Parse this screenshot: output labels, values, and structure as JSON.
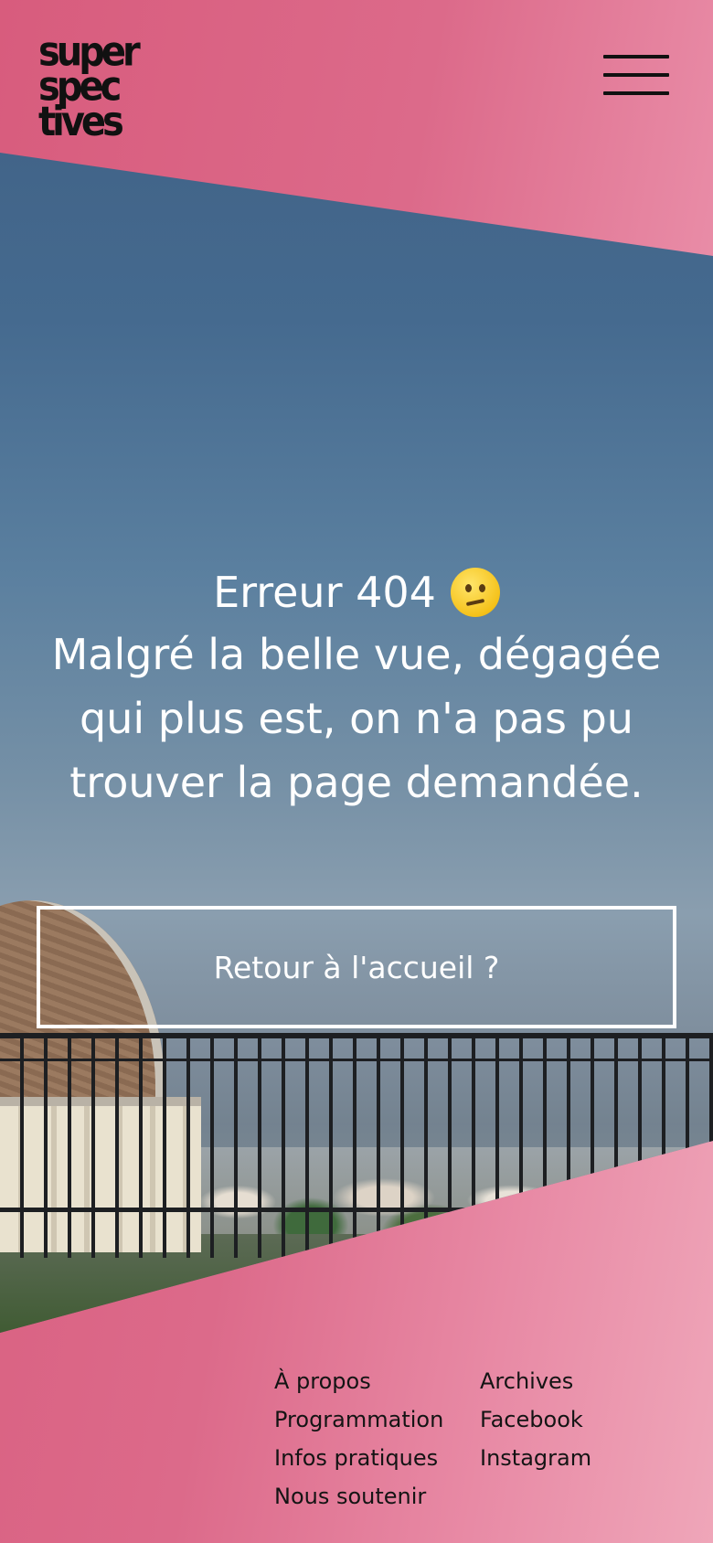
{
  "header": {
    "logo_lines": [
      "super",
      "spec",
      "tives"
    ],
    "menu_icon": "hamburger-menu-icon"
  },
  "error": {
    "title": "Erreur 404",
    "emoji": "confused-face-emoji",
    "message": "Malgré la belle vue, dégagée qui plus est, on n'a pas pu trouver la page demandée."
  },
  "cta": {
    "label": "Retour à l'accueil ?"
  },
  "footer": {
    "col1": [
      "À propos",
      "Programmation",
      "Infos pratiques",
      "Nous soutenir"
    ],
    "col2": [
      "Archives",
      "Facebook",
      "Instagram"
    ]
  },
  "colors": {
    "pink_start": "#d85c7d",
    "pink_end": "#efa6b9",
    "text_light": "#ffffff",
    "text_dark": "#141414"
  }
}
